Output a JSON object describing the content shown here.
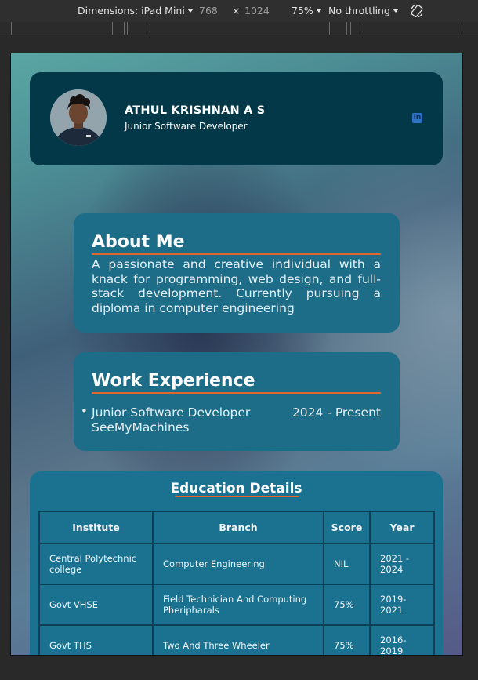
{
  "devtools": {
    "dimensions_label": "Dimensions: iPad Mini",
    "width": "768",
    "times": "×",
    "height": "1024",
    "zoom": "75%",
    "throttling": "No throttling"
  },
  "profile": {
    "name": "ATHUL KRISHNAN A S",
    "role": "Junior Software Developer",
    "linkedin_icon": "in"
  },
  "about": {
    "heading": "About Me",
    "text": "A passionate and creative individual with a knack for programming, web design, and full-stack development. Currently pursuing a diploma in computer engineering"
  },
  "experience": {
    "heading": "Work Experience",
    "items": [
      {
        "title": "Junior Software Developer",
        "company": "SeeMyMachines",
        "period": "2024 - Present"
      }
    ]
  },
  "education": {
    "heading": "Education Details",
    "columns": [
      "Institute",
      "Branch",
      "Score",
      "Year"
    ],
    "rows": [
      [
        "Central Polytechnic college",
        "Computer Engineering",
        "NIL",
        "2021 - 2024"
      ],
      [
        "Govt VHSE",
        "Field Technician And Computing Pheripharals",
        "75%",
        "2019-2021"
      ],
      [
        "Govt THS",
        "Two And Three Wheeler",
        "75%",
        "2016-2019"
      ]
    ]
  },
  "colors": {
    "card_dark": "#023848",
    "card_teal": "#1d6d89",
    "accent_underline": "#e0662e",
    "linkedin_blue": "#2e72c6"
  }
}
